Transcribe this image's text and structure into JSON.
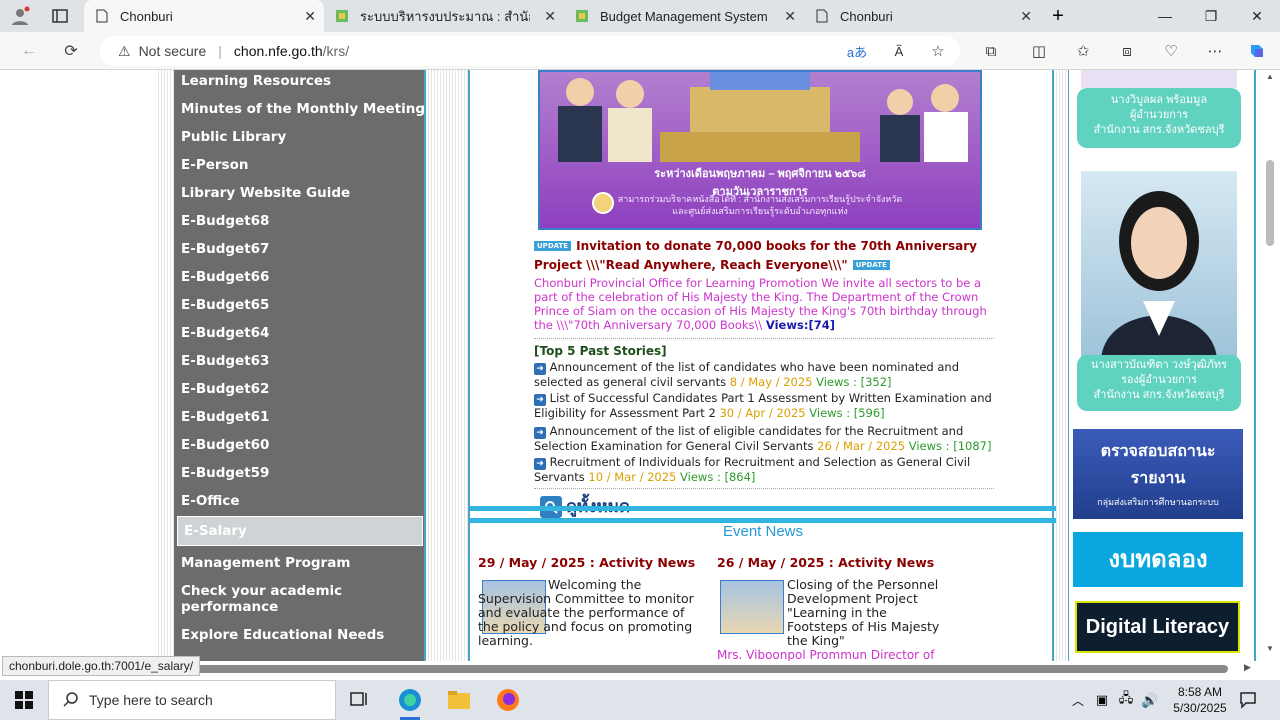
{
  "browser": {
    "tabs": [
      {
        "title": "Chonburi",
        "active": true
      },
      {
        "title": "ระบบบริหารงบประมาณ : สำนักงาน กศน",
        "active": false
      },
      {
        "title": "Budget Management System : Of",
        "active": false
      },
      {
        "title": "Chonburi",
        "active": false
      }
    ],
    "address": {
      "security": "Not secure",
      "host": "chon.nfe.go.th",
      "path": "/krs/"
    },
    "status_url": "chonburi.dole.go.th:7001/e_salary/"
  },
  "sidebar": {
    "items": [
      "Learning Resources",
      "Minutes of the Monthly Meeting",
      "Public Library",
      "E-Person",
      "Library Website Guide",
      "E-Budget68",
      "E-Budget67",
      "E-Budget66",
      "E-Budget65",
      "E-Budget64",
      "E-Budget63",
      "E-Budget62",
      "E-Budget61",
      "E-Budget60",
      "E-Budget59",
      "E-Office",
      "E-Salary",
      "Management Program",
      "Check your academic performance",
      "Explore Educational Needs"
    ],
    "selected": "E-Salary"
  },
  "banner": {
    "line1": "ระหว่างเดือนพฤษภาคม – พฤศจิกายน ๒๕๖๘",
    "line1b": "ตามวันเวลาราชการ",
    "line2": "สามารถร่วมบริจาคหนังสือได้ที่ : สำนักงานส่งเสริมการเรียนรู้ประจำจังหวัด",
    "line3": "และศูนย์ส่งเสริมการเรียนรู้ระดับอำเภอทุกแห่ง"
  },
  "headline": {
    "badge": "UPDATE",
    "title": "Invitation to donate 70,000 books for the 70th Anniversary Project \\\\\\\"Read Anywhere, Reach Everyone\\\\\\\"",
    "body": "Chonburi Provincial Office for Learning Promotion We invite all sectors to be a part of the celebration of His Majesty the King. The Department of the Crown Prince of Siam on the occasion of His Majesty the King's 70th birthday through the \\\\\\\"70th Anniversary 70,000 Books\\\\",
    "views_label": "Views:",
    "views": "[74]"
  },
  "top5": {
    "heading": "[Top 5 Past Stories]",
    "stories": [
      {
        "text": "Announcement of the list of candidates who have been nominated and selected as general civil servants",
        "date": "8 / May / 2025",
        "views": "Views : [352]"
      },
      {
        "text": "List of Successful Candidates Part 1 Assessment by Written Examination and Eligibility for Assessment Part 2",
        "date": "30 / Apr / 2025",
        "views": "Views : [596]"
      },
      {
        "text": "Announcement of the list of eligible candidates for the Recruitment and Selection Examination for General Civil Servants",
        "date": "26 / Mar / 2025",
        "views": "Views : [1087]"
      },
      {
        "text": "Recruitment of Individuals for Recruitment and Selection as General Civil Servants",
        "date": "10 / Mar / 2025",
        "views": "Views : [864]"
      }
    ],
    "view_all": "ดูทั้งหมด"
  },
  "events": {
    "heading": "Event News",
    "items": [
      {
        "date": "29 / May / 2025 : Activity News",
        "text": "Welcoming the Supervision Committee to monitor and evaluate the performance of the policy and focus on promoting learning."
      },
      {
        "date": "26 / May / 2025 : Activity News",
        "text": "Closing of the Personnel Development Project \"Learning in the Footsteps of His Majesty the King\"",
        "sub": "Mrs. Viboonpol Prommun Director of the"
      }
    ]
  },
  "right": {
    "person1": [
      "นางวิบูลผล พร้อมมูล",
      "ผู้อำนวยการ",
      "สำนักงาน สกร.จังหวัดชลบุรี"
    ],
    "person2": [
      "นางสาวบัณฑิตา วงษ์วุฒิภัทร",
      "รองผู้อำนวยการ",
      "สำนักงาน สกร.จังหวัดชลบุรี"
    ],
    "banner1": [
      "ตรวจสอบสถานะ",
      "รายงาน",
      "กลุ่มส่งเสริมการศึกษานอกระบบ"
    ],
    "banner2": "งบทดลอง",
    "banner3": "Digital Literacy"
  },
  "taskbar": {
    "search_placeholder": "Type here to search",
    "time": "8:58 AM",
    "date": "5/30/2025"
  }
}
